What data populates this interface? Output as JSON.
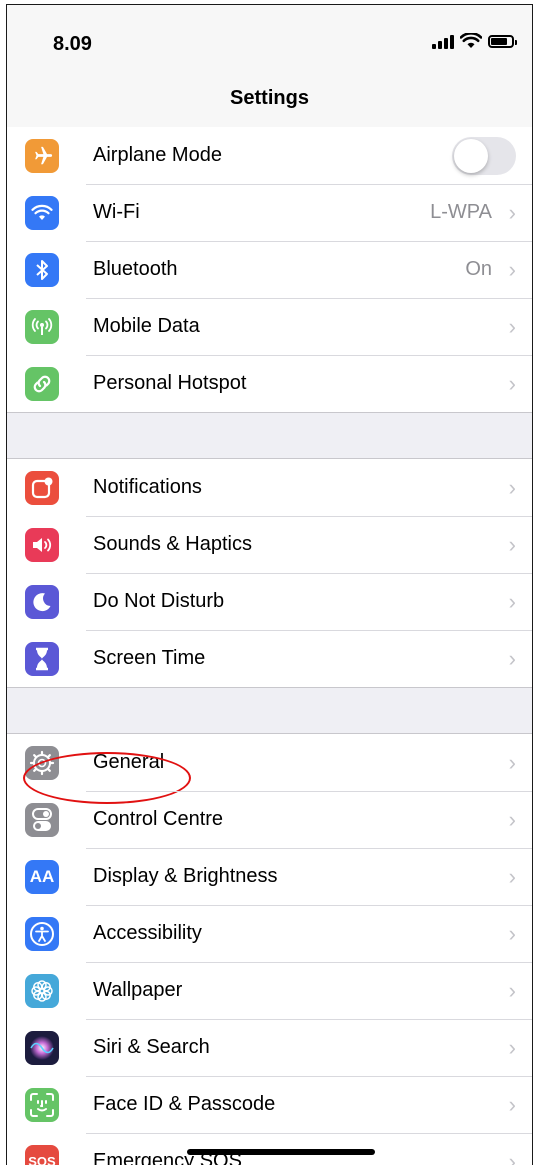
{
  "status_bar": {
    "time": "8.09"
  },
  "nav": {
    "title": "Settings"
  },
  "colors": {
    "airplane": "#f19a37",
    "wifi": "#3478f6",
    "bluetooth": "#3478f6",
    "mobile": "#65c466",
    "hotspot": "#65c466",
    "notifications": "#eb4e3d",
    "sounds": "#e93a58",
    "dnd": "#5b58d6",
    "screentime": "#5b58d6",
    "general": "#8e8e93",
    "control": "#8e8e93",
    "display": "#3478f6",
    "accessibility": "#3478f6",
    "wallpaper": "#45a8d9",
    "siri": "#1c1c3e",
    "faceid": "#65c466",
    "sos": "#e54a3f",
    "annotation": "#e11111"
  },
  "groups": [
    {
      "rows": [
        {
          "label": "Airplane Mode",
          "icon": "airplane-icon",
          "control": "toggle",
          "toggle_on": false
        },
        {
          "label": "Wi-Fi",
          "icon": "wifi-icon",
          "value": "L-WPA"
        },
        {
          "label": "Bluetooth",
          "icon": "bluetooth-icon",
          "value": "On"
        },
        {
          "label": "Mobile Data",
          "icon": "antenna-icon"
        },
        {
          "label": "Personal Hotspot",
          "icon": "link-icon"
        }
      ]
    },
    {
      "rows": [
        {
          "label": "Notifications",
          "icon": "notifications-icon"
        },
        {
          "label": "Sounds & Haptics",
          "icon": "speaker-icon"
        },
        {
          "label": "Do Not Disturb",
          "icon": "moon-icon"
        },
        {
          "label": "Screen Time",
          "icon": "hourglass-icon"
        }
      ]
    },
    {
      "rows": [
        {
          "label": "General",
          "icon": "gear-icon",
          "annotated": true
        },
        {
          "label": "Control Centre",
          "icon": "switches-icon"
        },
        {
          "label": "Display & Brightness",
          "icon": "text-size-icon",
          "icon_text": "AA"
        },
        {
          "label": "Accessibility",
          "icon": "accessibility-icon"
        },
        {
          "label": "Wallpaper",
          "icon": "flower-icon"
        },
        {
          "label": "Siri & Search",
          "icon": "siri-icon"
        },
        {
          "label": "Face ID & Passcode",
          "icon": "face-id-icon"
        },
        {
          "label": "Emergency SOS",
          "icon": "sos-icon",
          "icon_text": "SOS"
        }
      ]
    }
  ]
}
